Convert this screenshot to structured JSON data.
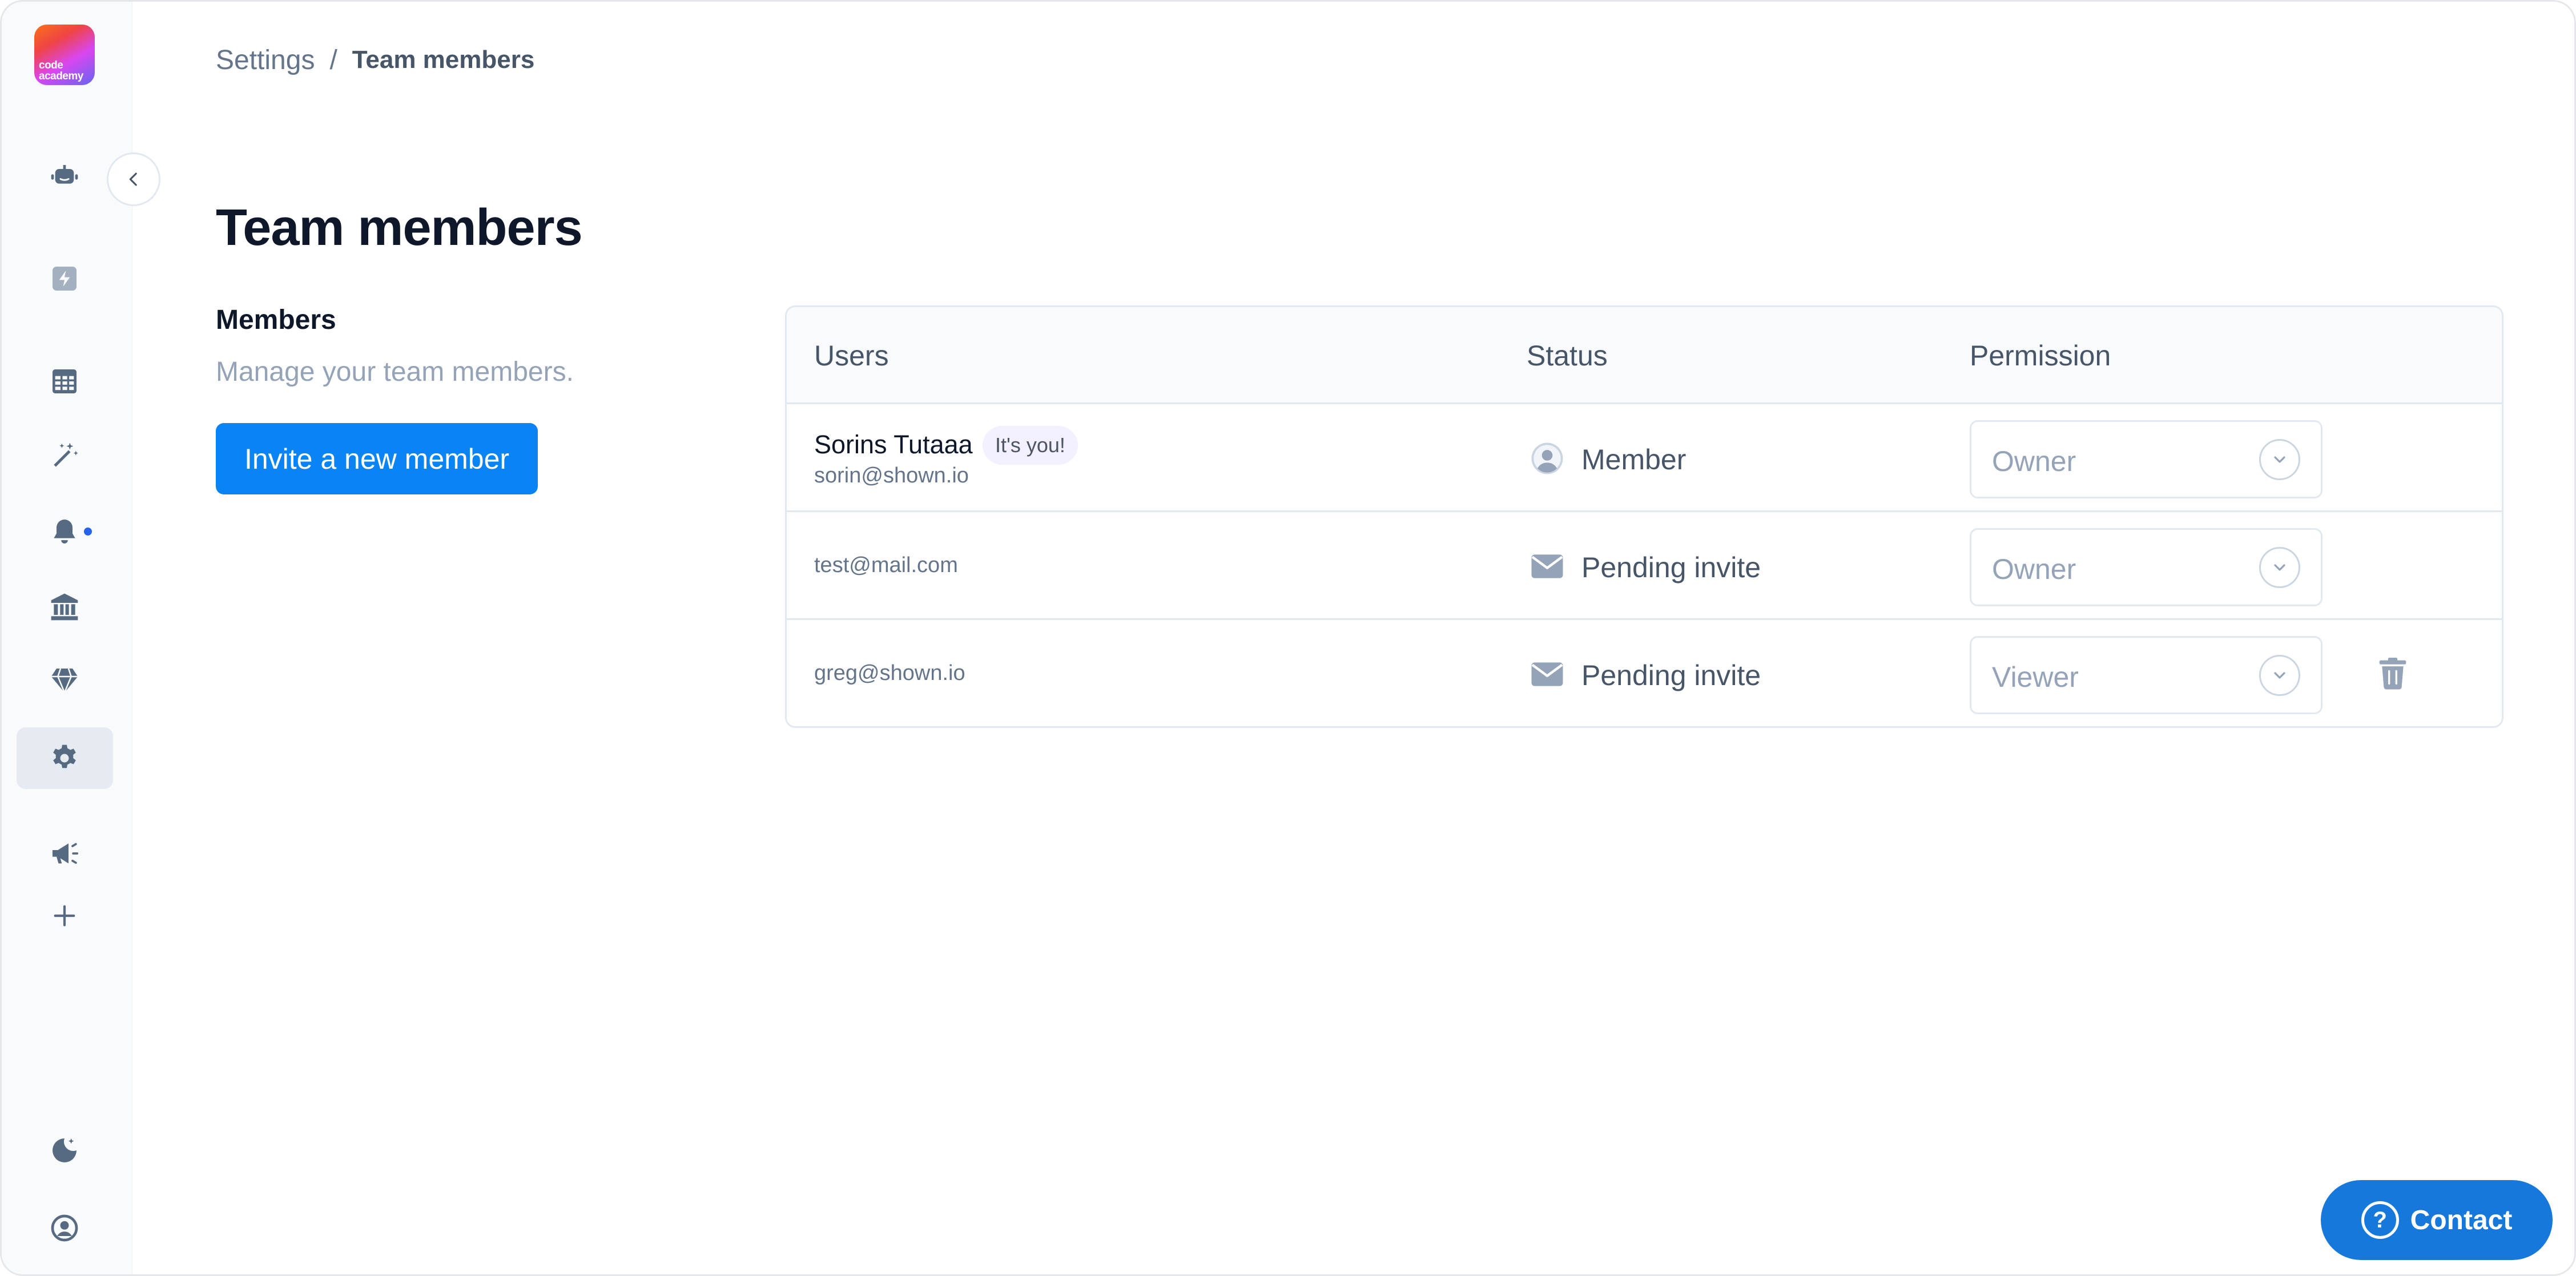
{
  "app": {
    "logo_text": "code academy"
  },
  "breadcrumb": {
    "root": "Settings",
    "separator": "/",
    "current": "Team members"
  },
  "page": {
    "title": "Team members"
  },
  "members_panel": {
    "heading": "Members",
    "description": "Manage your team members.",
    "invite_label": "Invite a new member"
  },
  "table": {
    "columns": {
      "users": "Users",
      "status": "Status",
      "permission": "Permission"
    },
    "rows": [
      {
        "name": "Sorins Tutaaa",
        "badge": "It's you!",
        "email": "sorin@shown.io",
        "status": "Member",
        "status_icon": "user-circle-icon",
        "permission": "Owner"
      },
      {
        "email": "test@mail.com",
        "status": "Pending invite",
        "status_icon": "envelope-icon",
        "permission": "Owner"
      },
      {
        "email": "greg@shown.io",
        "status": "Pending invite",
        "status_icon": "envelope-icon",
        "permission": "Viewer"
      }
    ]
  },
  "contact": {
    "label": "Contact",
    "glyph": "?"
  },
  "sidebar": {
    "icons": [
      "robot-icon",
      "lightning-icon",
      "table-icon",
      "magic-wand-icon",
      "bell-icon",
      "bank-icon",
      "diamond-icon",
      "gear-icon",
      "megaphone-icon",
      "plus-icon",
      "moon-icon",
      "user-circle-icon"
    ],
    "active": "gear-icon"
  },
  "colors": {
    "primary": "#0a84f5",
    "contact": "#1778dc",
    "icon": "#566a82",
    "notification": "#2563eb"
  }
}
